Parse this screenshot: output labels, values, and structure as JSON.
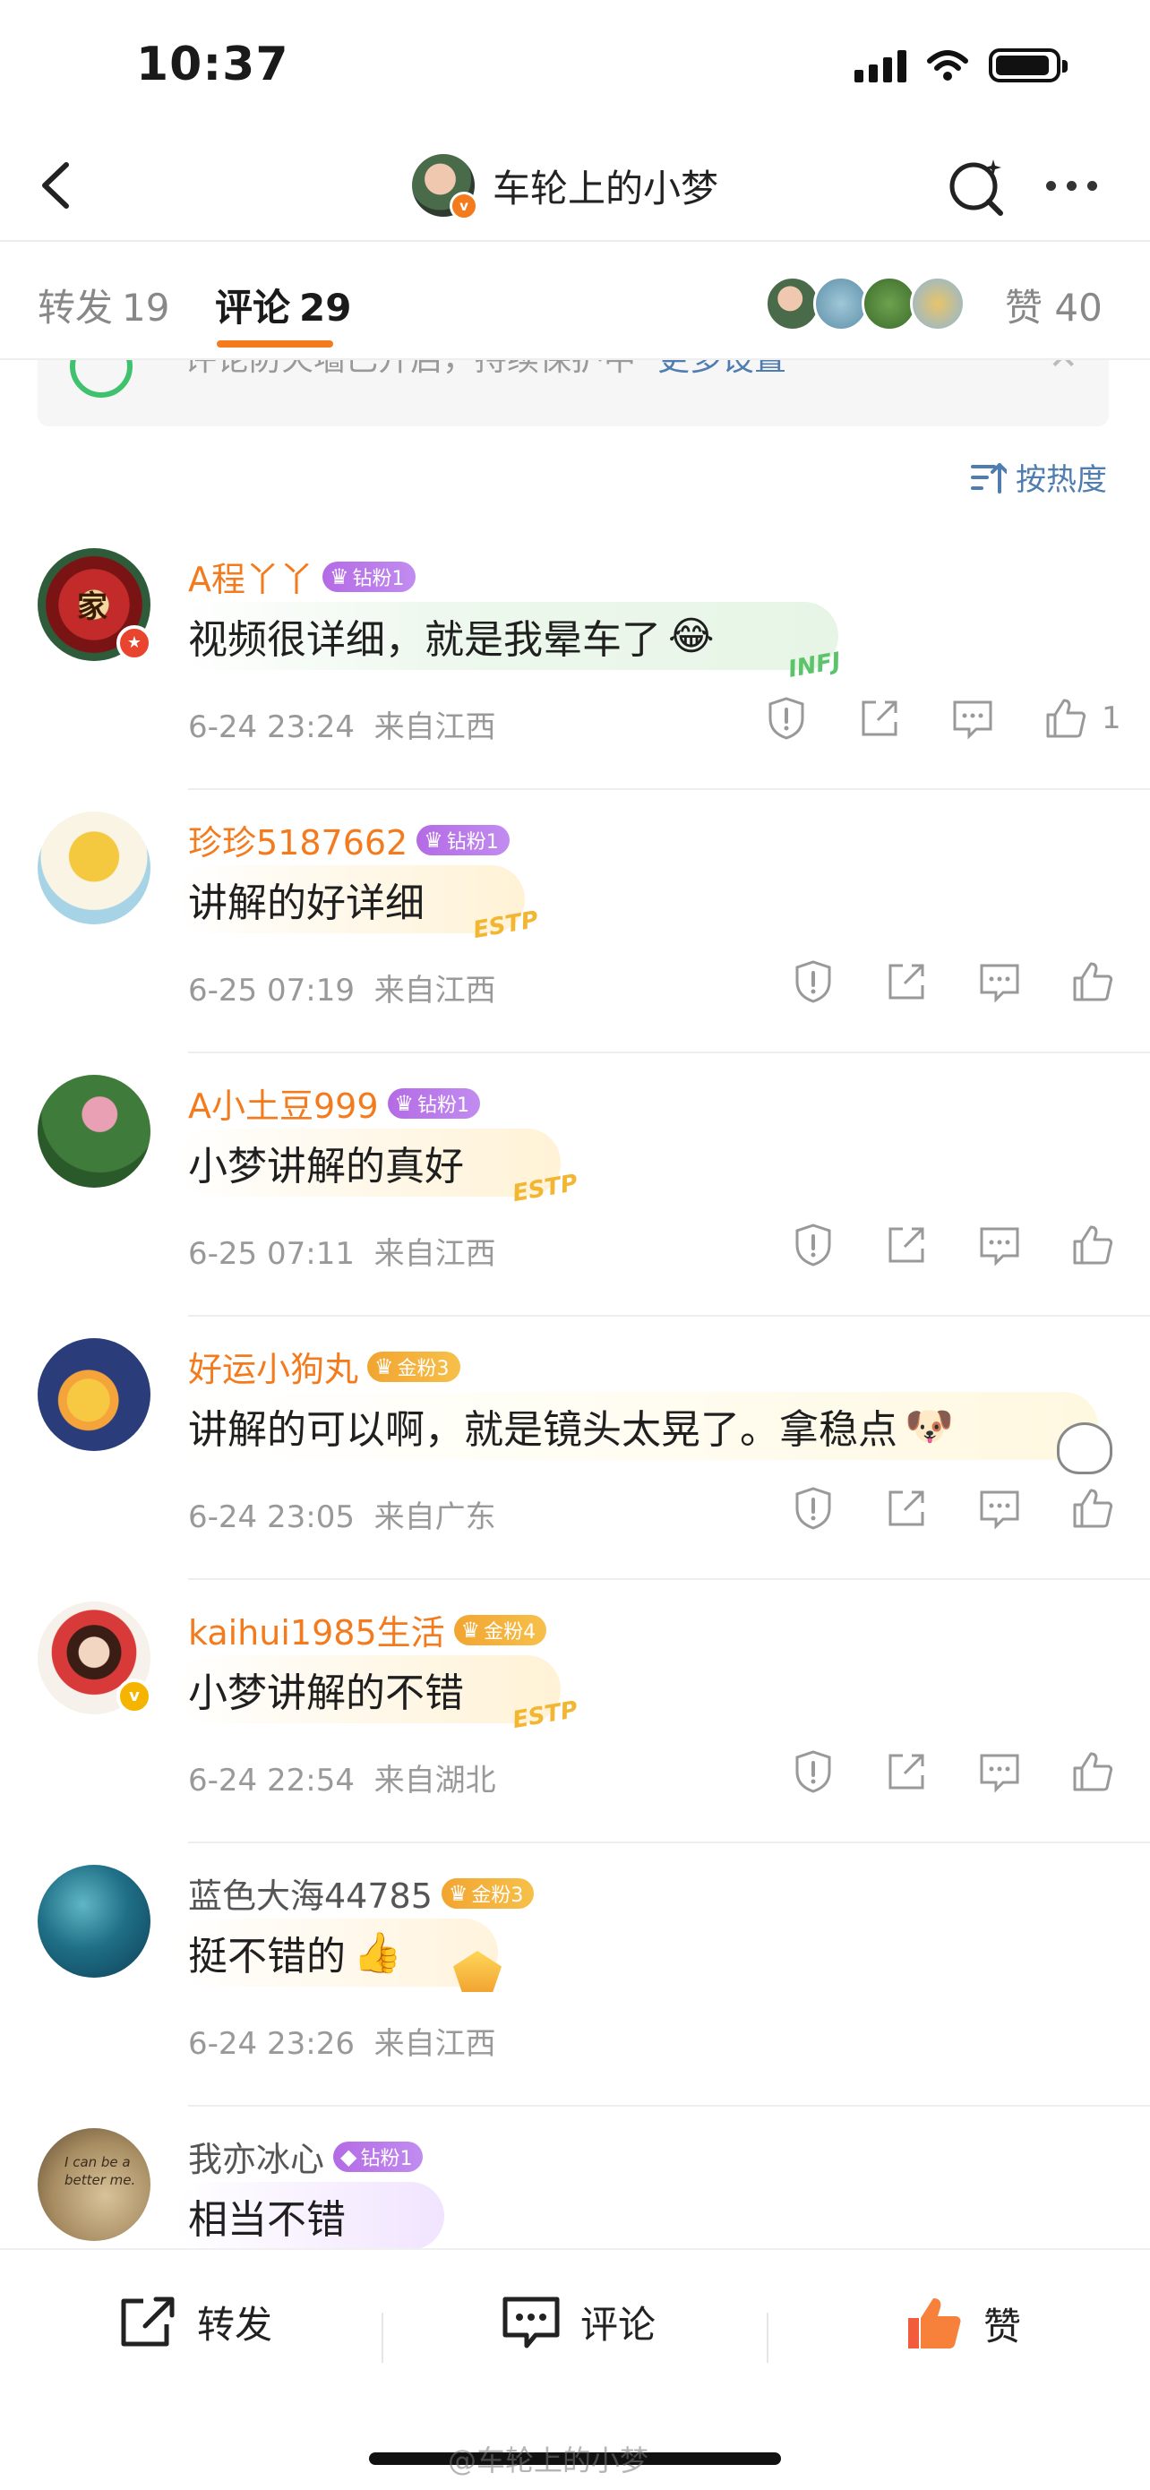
{
  "status_bar": {
    "time": "10:37",
    "battery_level": 0.92
  },
  "nav": {
    "title": "车轮上的小梦",
    "verified_mark": "v"
  },
  "tabs": {
    "reposts": {
      "label": "转发",
      "count": "19"
    },
    "comments": {
      "label": "评论",
      "count": "29"
    },
    "likes": {
      "label": "赞",
      "count": "40"
    }
  },
  "notice": {
    "text": "评论防火墙已开启，持续保护中",
    "link": "更多设置"
  },
  "sort": {
    "label": "按热度"
  },
  "comments": [
    {
      "user": "A程丫丫",
      "badge": "钻粉1",
      "badge_type": "diamond",
      "text": "视频很详细，就是我晕车了",
      "emoji": "😂",
      "bubble_tag": "INFJ",
      "time": "6-24 23:24",
      "location": "来自江西",
      "likes": "1",
      "avatar_badge": "red"
    },
    {
      "user": "珍珍5187662",
      "badge": "钻粉1",
      "badge_type": "diamond",
      "text": "讲解的好详细",
      "emoji": "",
      "bubble_tag": "ESTP",
      "time": "6-25 07:19",
      "location": "来自江西",
      "likes": "",
      "avatar_badge": ""
    },
    {
      "user": "A小土豆999",
      "badge": "钻粉1",
      "badge_type": "diamond",
      "text": "小梦讲解的真好",
      "emoji": "",
      "bubble_tag": "ESTP",
      "time": "6-25 07:11",
      "location": "来自江西",
      "likes": "",
      "avatar_badge": ""
    },
    {
      "user": "好运小狗丸",
      "badge": "金粉3",
      "badge_type": "gold",
      "text": "讲解的可以啊，就是镜头太晃了。拿稳点",
      "emoji": "🐶",
      "bubble_tag": "",
      "time": "6-24 23:05",
      "location": "来自广东",
      "likes": "",
      "avatar_badge": ""
    },
    {
      "user": "kaihui1985生活",
      "badge": "金粉4",
      "badge_type": "gold",
      "text": "小梦讲解的不错",
      "emoji": "",
      "bubble_tag": "ESTP",
      "time": "6-24 22:54",
      "location": "来自湖北",
      "likes": "",
      "avatar_badge": "yellow"
    },
    {
      "user": "蓝色大海44785",
      "badge": "金粉3",
      "badge_type": "gold",
      "text": "挺不错的",
      "emoji": "👍",
      "bubble_tag": "",
      "time": "6-24 23:26",
      "location": "来自江西",
      "likes": "",
      "avatar_badge": ""
    },
    {
      "user": "我亦冰心",
      "badge": "钻粉1",
      "badge_type": "diamond",
      "text": "相当不错",
      "emoji": "",
      "bubble_tag": "",
      "time": "",
      "location": "",
      "likes": "",
      "avatar_badge": ""
    }
  ],
  "avatar_texts": {
    "family_char": "家",
    "note": "I can be a better me."
  },
  "toolbar": {
    "repost": "转发",
    "comment": "评论",
    "like": "赞"
  },
  "watermark": "@车轮上的小梦",
  "colors": {
    "accent": "#f37b1d",
    "link": "#507daf",
    "like_red": "#f25b3b"
  }
}
